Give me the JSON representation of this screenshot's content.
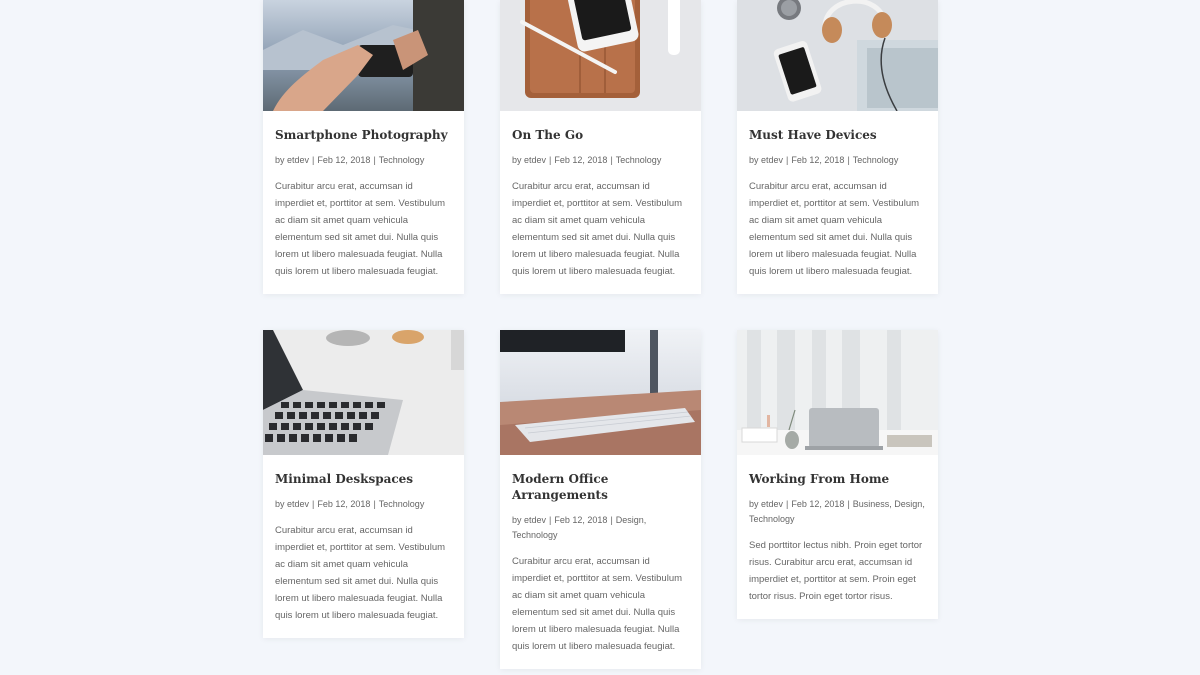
{
  "posts": [
    {
      "title": "Smartphone Photography",
      "author": "etdev",
      "date": "Feb 12, 2018",
      "categories": "Technology",
      "excerpt": "Curabitur arcu erat, accumsan id imperdiet et, porttitor at sem. Vestibulum ac diam sit amet quam vehicula elementum sed sit amet dui. Nulla quis lorem ut libero malesuada feugiat. Nulla quis lorem ut libero malesuada feugiat."
    },
    {
      "title": "On The Go",
      "author": "etdev",
      "date": "Feb 12, 2018",
      "categories": "Technology",
      "excerpt": "Curabitur arcu erat, accumsan id imperdiet et, porttitor at sem. Vestibulum ac diam sit amet quam vehicula elementum sed sit amet dui. Nulla quis lorem ut libero malesuada feugiat. Nulla quis lorem ut libero malesuada feugiat."
    },
    {
      "title": "Must Have Devices",
      "author": "etdev",
      "date": "Feb 12, 2018",
      "categories": "Technology",
      "excerpt": "Curabitur arcu erat, accumsan id imperdiet et, porttitor at sem. Vestibulum ac diam sit amet quam vehicula elementum sed sit amet dui. Nulla quis lorem ut libero malesuada feugiat. Nulla quis lorem ut libero malesuada feugiat."
    },
    {
      "title": "Minimal Deskspaces",
      "author": "etdev",
      "date": "Feb 12, 2018",
      "categories": "Technology",
      "excerpt": "Curabitur arcu erat, accumsan id imperdiet et, porttitor at sem. Vestibulum ac diam sit amet quam vehicula elementum sed sit amet dui. Nulla quis lorem ut libero malesuada feugiat. Nulla quis lorem ut libero malesuada feugiat."
    },
    {
      "title": "Modern Office Arrangements",
      "author": "etdev",
      "date": "Feb 12, 2018",
      "categories": "Design, Technology",
      "excerpt": "Curabitur arcu erat, accumsan id imperdiet et, porttitor at sem. Vestibulum ac diam sit amet quam vehicula elementum sed sit amet dui. Nulla quis lorem ut libero malesuada feugiat. Nulla quis lorem ut libero malesuada feugiat."
    },
    {
      "title": "Working From Home",
      "author": "etdev",
      "date": "Feb 12, 2018",
      "categories": "Business, Design, Technology",
      "excerpt": "Sed porttitor lectus nibh. Proin eget tortor risus. Curabitur arcu erat, accumsan id imperdiet et, porttitor at sem. Proin eget tortor risus. Proin eget tortor risus."
    }
  ],
  "meta_prefix": "by",
  "meta_separator": "|",
  "colors": {
    "page_background": "#f3f6fb",
    "card_background": "#ffffff",
    "title_text": "#333333",
    "body_text": "#666666"
  }
}
